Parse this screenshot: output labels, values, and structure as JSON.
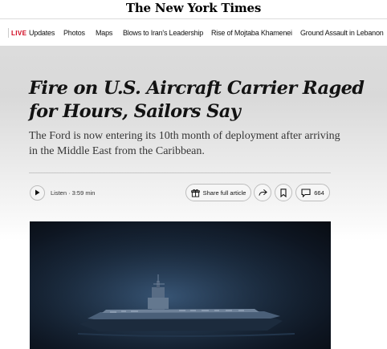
{
  "masthead": {
    "logo": "The New York Times"
  },
  "subnav": {
    "live_tag": "LIVE",
    "items": [
      "Updates",
      "Photos",
      "Maps",
      "Blows to Iran's Leadership",
      "Rise of Mojtaba Khamenei",
      "Ground Assault in Lebanon"
    ]
  },
  "article": {
    "headline": "Fire on U.S. Aircraft Carrier Raged for Hours, Sailors Say",
    "summary": "The Ford is now entering its 10th month of deployment after arriving in the Middle East from the Caribbean."
  },
  "toolbar": {
    "listen_label": "Listen · 3:59 min",
    "share_label": "Share full article",
    "comments_count": "664"
  },
  "icons": {
    "play": "play-icon",
    "gift": "gift-icon",
    "share": "share-arrow-icon",
    "bookmark": "bookmark-icon",
    "comment": "comment-icon"
  },
  "colors": {
    "live_red": "#d0021b",
    "text": "#121212"
  }
}
